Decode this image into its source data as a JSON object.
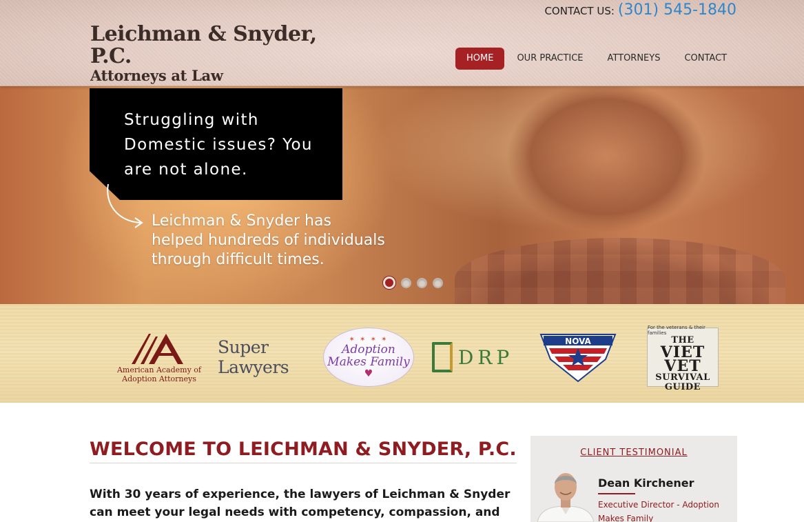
{
  "header": {
    "logo_main": "Leichman & Snyder, P.C.",
    "logo_sub": "Attorneys at Law",
    "contact_label": "CONTACT US:",
    "contact_phone": "(301) 545-1840",
    "nav": [
      {
        "label": "HOME",
        "active": true
      },
      {
        "label": "OUR PRACTICE",
        "active": false
      },
      {
        "label": "ATTORNEYS",
        "active": false
      },
      {
        "label": "CONTACT",
        "active": false
      }
    ]
  },
  "hero": {
    "headline": "Struggling with Domestic issues? You are not alone.",
    "subtext": "Leichman & Snyder has helped hundreds of individuals through difficult times.",
    "slides_total": 4,
    "active_slide": 1
  },
  "partners": {
    "aaaa": {
      "line1": "American Academy of",
      "line2": "Adoption Attorneys"
    },
    "super_lawyers": "Super Lawyers",
    "adoption": {
      "line1": "Adoption",
      "line2": "Makes Family"
    },
    "cdrp": "DRP",
    "cdrp_initial": "C",
    "nova": "NOVA",
    "viet_vet": {
      "small": "For the veterans & their families",
      "line1": "THE",
      "line2": "VIET",
      "line3": "VET",
      "line4": "SURVIVAL",
      "line5": "GUIDE"
    }
  },
  "main": {
    "title": "WELCOME TO LEICHMAN & SNYDER, P.C.",
    "body": "With 30 years of experience, the lawyers of Leichman & Snyder can meet your legal needs with competency, compassion, and"
  },
  "testimonial": {
    "heading": "CLIENT TESTIMONIAL",
    "name": "Dean Kirchener",
    "role": "Executive Director - Adoption Makes Family"
  },
  "colors": {
    "brand_red": "#8e1c20",
    "nav_active": "#a62124",
    "phone_blue": "#2f86c9"
  }
}
